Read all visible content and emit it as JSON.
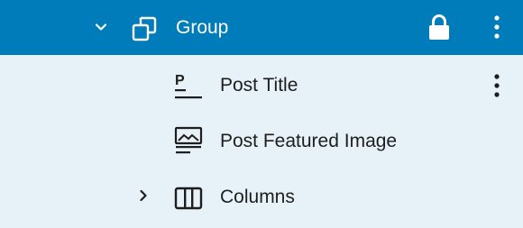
{
  "colors": {
    "selected_bg": "#007cba",
    "selected_fg": "#ffffff",
    "panel_bg": "#e7f1f8",
    "text": "#1e1e1e"
  },
  "tree": {
    "group": {
      "label": "Group",
      "icons": [
        "chevron-down-icon",
        "group-block-icon",
        "lock-icon",
        "more-options-icon"
      ]
    },
    "children": [
      {
        "label": "Post Title",
        "icon": "post-title-icon",
        "has_options": true
      },
      {
        "label": "Post Featured Image",
        "icon": "post-featured-image-icon",
        "has_options": false
      },
      {
        "label": "Columns",
        "icon": "columns-icon",
        "expandable": true
      }
    ]
  }
}
